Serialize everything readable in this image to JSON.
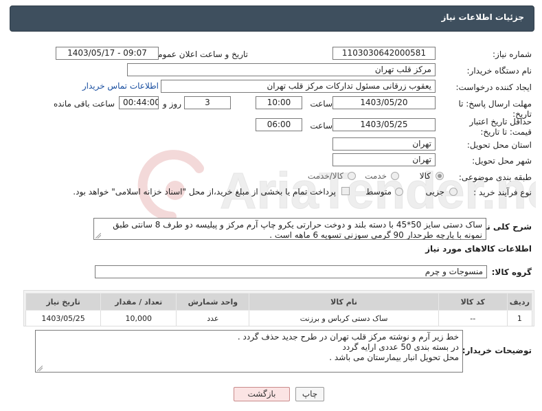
{
  "header": {
    "title": "جزئیات اطلاعات نیاز"
  },
  "form": {
    "need_number_label": "شماره نیاز:",
    "need_number": "1103030642000581",
    "announce_label": "تاریخ و ساعت اعلان عمومی:",
    "announce_value": "1403/05/17 - 09:07",
    "buyer_org_label": "نام دستگاه خریدار:",
    "buyer_org": "مرکز قلب تهران",
    "creator_label": "ایجاد کننده درخواست:",
    "creator": "یعقوب زرقانی مسئول تدارکات مرکز قلب تهران",
    "contact_link": "اطلاعات تماس خریدار",
    "reply_deadline_label": "مهلت ارسال پاسخ: تا تاریخ:",
    "reply_date": "1403/05/20",
    "time_label": "ساعت",
    "reply_time": "10:00",
    "days_value": "3",
    "days_and_label": "روز و",
    "remaining_time": "00:44:00",
    "remaining_label": "ساعت باقی مانده",
    "validity_label": "حداقل تاریخ اعتبار قیمت: تا تاریخ:",
    "validity_date": "1403/05/25",
    "validity_time": "06:00",
    "province_label": "استان محل تحویل:",
    "province": "تهران",
    "city_label": "شهر محل تحویل:",
    "city": "تهران",
    "category_label": "طبقه بندی موضوعی:",
    "category_options": [
      "کالا",
      "خدمت",
      "کالا/خدمت"
    ],
    "process_label": "نوع فرآیند خرید :",
    "process_options": [
      "جزیی",
      "متوسط"
    ],
    "process_note": "پرداخت تمام یا بخشی از مبلغ خرید،از محل \"اسناد خزانه اسلامی\" خواهد بود.",
    "description_label": "شرح کلی نیاز:",
    "description": "ساک دستی سایز 50*45 با دسته بلند و دوخت حرارتی یکرو چاپ آرم مرکز و پیلیسه دو طرف 8 سانتی طبق نمونه با پارچه طرحدار 90 گرمی سوزنی تسویه 6 ماهه است ."
  },
  "goods": {
    "section_title": "اطلاعات کالاهای مورد نیاز",
    "group_label": "گروه کالا:",
    "group_value": "منسوجات و چرم",
    "columns": [
      "ردیف",
      "کد کالا",
      "نام کالا",
      "واحد شمارش",
      "تعداد / مقدار",
      "تاریخ نیاز"
    ],
    "rows": [
      [
        "1",
        "--",
        "ساک دستی کرباس و برزنت",
        "عدد",
        "10,000",
        "1403/05/25"
      ]
    ]
  },
  "notes": {
    "label": "توضیحات خریدار:",
    "lines": [
      "خط زیر آرم و نوشته مرکز قلب تهران در طرح جدید حذف گردد .",
      "در بسته بندی 50 عددی ارایه گردد",
      "محل تحویل انبار بیمارستان می باشد ."
    ]
  },
  "buttons": {
    "print": "چاپ",
    "back": "بازگشت"
  },
  "watermark": {
    "brand": "AriaTender.neT"
  },
  "colors": {
    "header_bg": "#3e4f5e",
    "link": "#1a4fa0",
    "back_button_bg": "#fbe4e4"
  }
}
